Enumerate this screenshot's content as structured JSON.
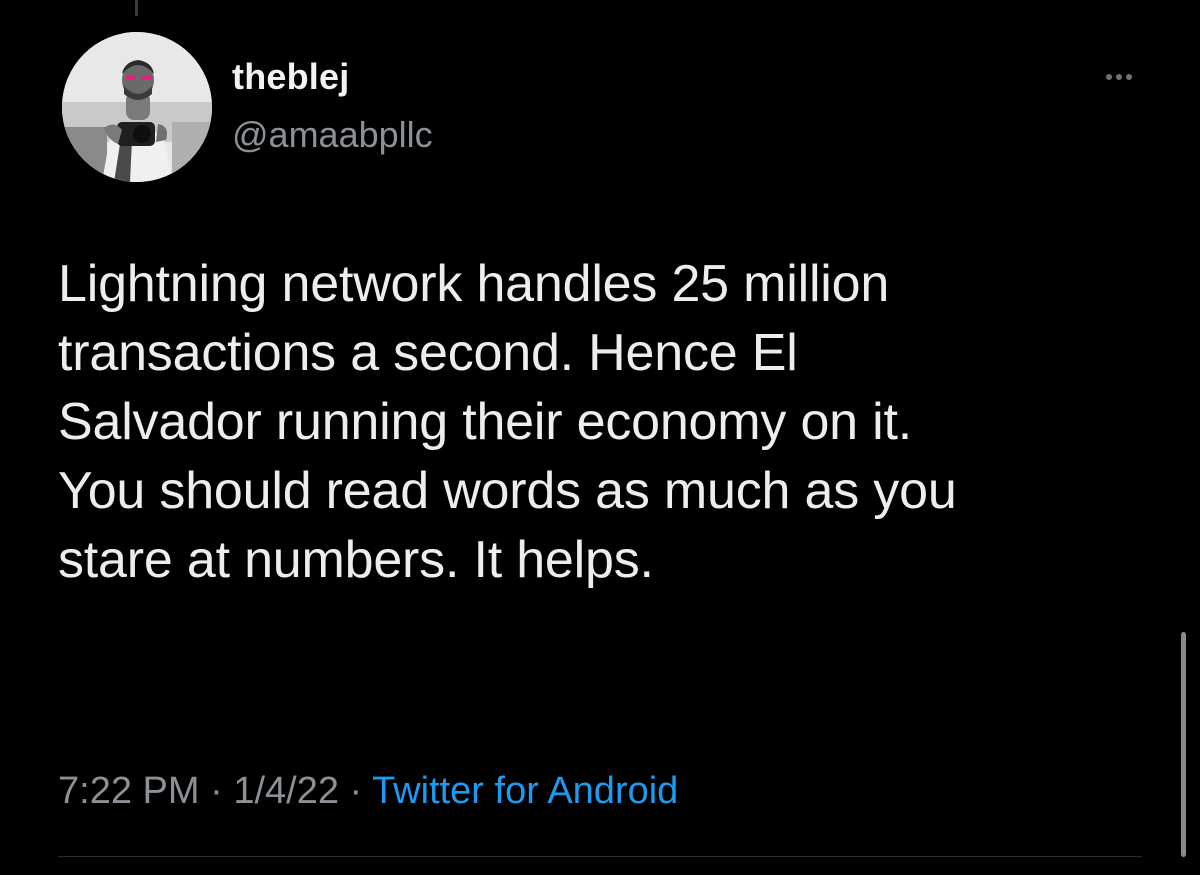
{
  "tweet": {
    "author": {
      "display_name": "theblej",
      "handle": "@amaabpllc"
    },
    "text_lines": [
      "Lightning network handles 25 million",
      "transactions a second. Hence El",
      "Salvador running their economy on it.",
      "You should read words as much as you",
      "stare at numbers. It helps."
    ],
    "meta": {
      "time": "7:22 PM",
      "date": "1/4/22",
      "separator": " · ",
      "source": "Twitter for Android"
    }
  },
  "icons": {
    "more": "more-horizontal-icon"
  },
  "colors": {
    "background": "#000000",
    "text": "#ededed",
    "secondary_text": "#8b9196",
    "link": "#1d9bf0"
  }
}
